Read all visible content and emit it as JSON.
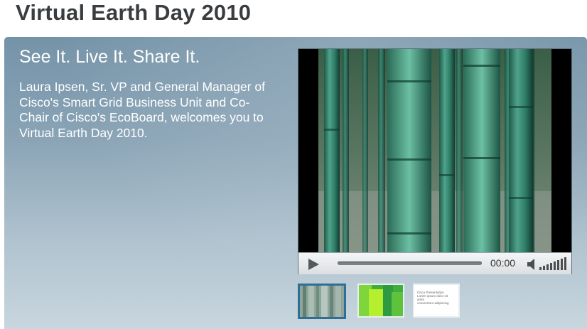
{
  "page": {
    "title": "Virtual Earth Day 2010"
  },
  "feature": {
    "tagline": "See It. Live It. Share It.",
    "intro": "Laura Ipsen, Sr. VP and General Manager of Cisco's Smart Grid Business Unit and Co-Chair of Cisco's EcoBoard, welcomes you to Virtual Earth Day 2010."
  },
  "player": {
    "time": "00:00",
    "progress": 0,
    "icons": {
      "play": "play-icon",
      "volume": "speaker-icon",
      "volume_level": "volume-bars-icon"
    }
  },
  "thumbnails": [
    {
      "name": "bamboo-video-thumbnail",
      "selected": true
    },
    {
      "name": "green-video-thumbnail",
      "selected": false
    },
    {
      "name": "slide-video-thumbnail",
      "selected": false,
      "lines": [
        "Cisco Presentation",
        "Lorem ipsum dolor sit amet",
        "consectetur adipiscing"
      ]
    }
  ],
  "colors": {
    "title": "#3a3d40",
    "panel_top": "#7593a8",
    "panel_bottom": "#c8d6de",
    "thumb_selected_border": "#2f6f95"
  }
}
